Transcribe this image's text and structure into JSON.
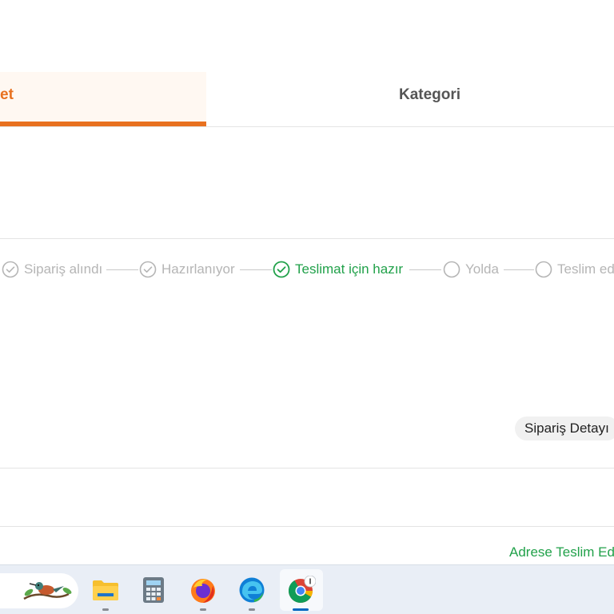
{
  "tabs": [
    {
      "label": "et",
      "active": true
    },
    {
      "label": "Kategori",
      "active": false
    }
  ],
  "order_progress": {
    "steps": [
      {
        "label": "Sipariş alındı",
        "state": "done"
      },
      {
        "label": "Hazırlanıyor",
        "state": "done"
      },
      {
        "label": "Teslimat için hazır",
        "state": "current"
      },
      {
        "label": "Yolda",
        "state": "pending"
      },
      {
        "label": "Teslim ed",
        "state": "pending"
      }
    ]
  },
  "order_detail_button": "Sipariş Detayı",
  "address_link": "Adrese Teslim Ed",
  "colors": {
    "accent": "#e8711f",
    "success": "#21a14a",
    "inactive": "#b5b5b5"
  },
  "taskbar": {
    "apps": [
      {
        "icon": "file-explorer-icon",
        "active": false
      },
      {
        "icon": "calculator-icon",
        "active": false
      },
      {
        "icon": "firefox-icon",
        "active": false
      },
      {
        "icon": "edge-icon",
        "active": false
      },
      {
        "icon": "chrome-icon",
        "active": true
      }
    ],
    "widget_icon": "weather-bird-widget-icon"
  }
}
